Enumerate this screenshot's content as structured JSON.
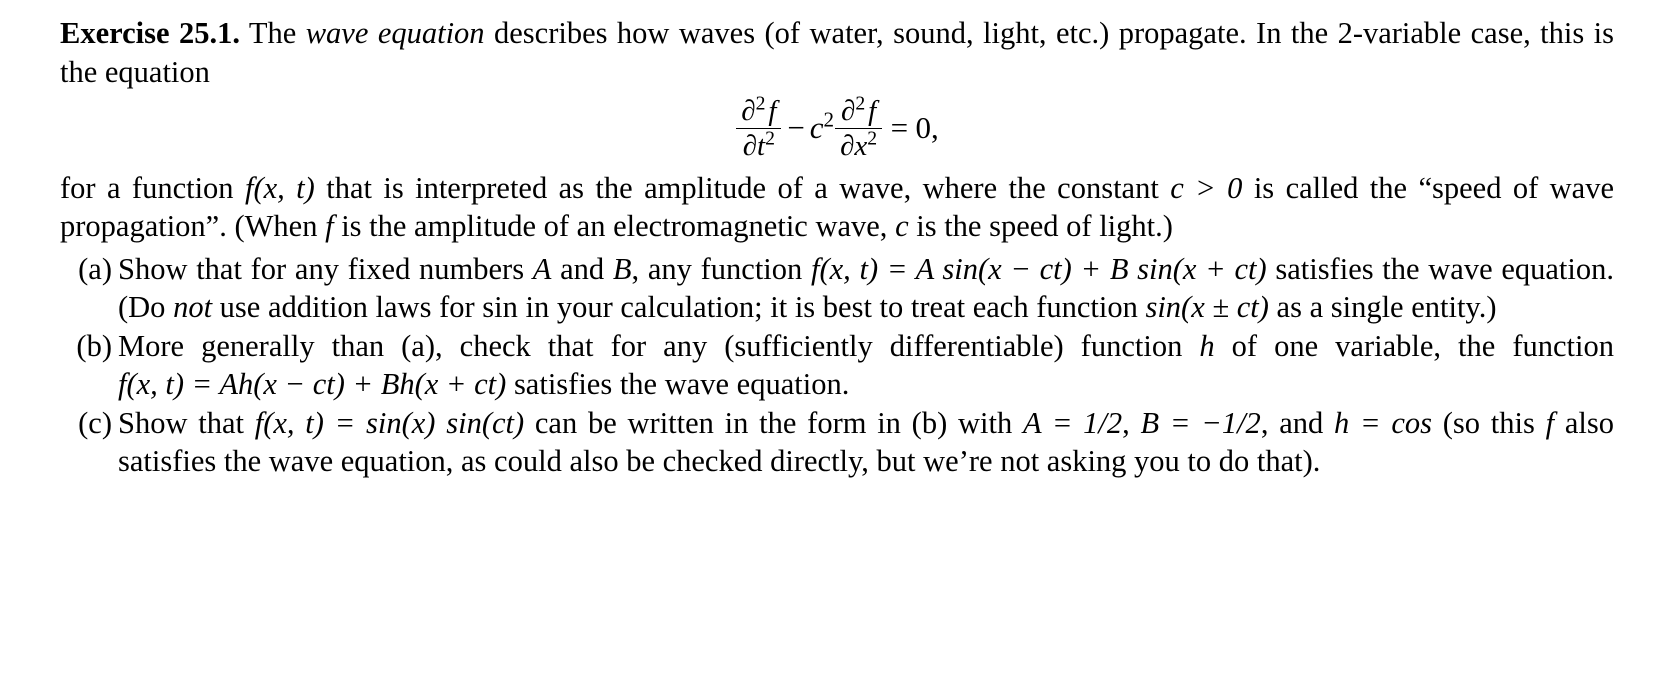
{
  "document": {
    "exercise_label": "Exercise 25.1.",
    "intro": {
      "part1": "The ",
      "emphasis": "wave equation",
      "part2": " describes how waves (of water, sound, light, etc.) propagate. In the 2-variable case, this is the equation"
    },
    "display_equation": {
      "latex_text": "\\partial^2 f / \\partial t^2 - c^2 \\partial^2 f / \\partial x^2 = 0,",
      "term1_numerator": "∂",
      "term1_numerator_exp": "2",
      "term1_numerator_fn": "f",
      "term1_denominator": "∂t",
      "term1_denominator_exp": "2",
      "minus": "−",
      "coefficient": "c",
      "coefficient_exp": "2",
      "term2_numerator": "∂",
      "term2_numerator_exp": "2",
      "term2_numerator_fn": "f",
      "term2_denominator": "∂x",
      "term2_denominator_exp": "2",
      "equals": "=",
      "rhs": "0,"
    },
    "paragraph2": {
      "s1": "for a function ",
      "m1": "f(x, t)",
      "s2": " that is interpreted as the amplitude of a wave, where the constant ",
      "m2": "c > 0",
      "s3": " is called the “speed of wave propagation”. (When ",
      "m3": "f",
      "s4": " is the amplitude of an electromagnetic wave, ",
      "m4": "c",
      "s5": " is the speed of light.)"
    },
    "items": [
      {
        "marker": "(a)",
        "s1": "Show that for any fixed numbers ",
        "m1": "A",
        "s2": " and ",
        "m2": "B",
        "s3": ", any function ",
        "m3": "f(x, t) = A sin(x − ct) + B sin(x + ct)",
        "s4": " satisfies the wave equation. (Do ",
        "em1": "not",
        "s5": " use addition laws for ",
        "m4": "sin",
        "s6": " in your calculation; it is best to treat each function ",
        "m5": "sin(x ± ct)",
        "s7": " as a single entity.)"
      },
      {
        "marker": "(b)",
        "s1": "More generally than (a), check that for any (sufficiently differentiable) function ",
        "m1": "h",
        "s2": " of one variable, the function ",
        "m2": "f(x, t) = Ah(x − ct) + Bh(x + ct)",
        "s3": " satisfies the wave equation."
      },
      {
        "marker": "(c)",
        "s1": "Show that ",
        "m1": "f(x, t) = sin(x) sin(ct)",
        "s2": " can be written in the form in (b) with ",
        "m2": "A = 1/2",
        "s3": ", ",
        "m3": "B = −1/2",
        "s4": ", and ",
        "m4": "h = cos",
        "s5": " (so this ",
        "m5": "f",
        "s6": " also satisfies the wave equation, as could also be checked directly, but we’re not asking you to do that)."
      }
    ]
  }
}
